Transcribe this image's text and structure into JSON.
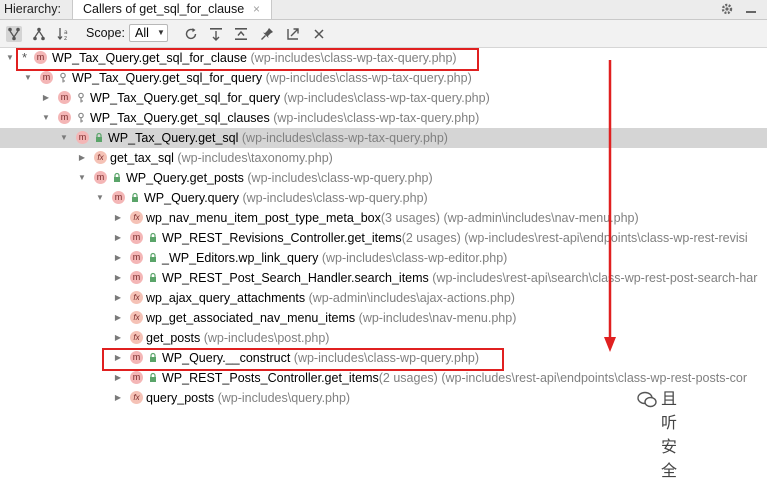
{
  "header": {
    "hierarchy_label": "Hierarchy:",
    "tab_title": "Callers of get_sql_for_clause",
    "tab_close": "×"
  },
  "toolbar": {
    "scope_label": "Scope:",
    "scope_value": "All",
    "icons": [
      "caller-hierarchy-icon",
      "callee-hierarchy-icon",
      "sort-alpha-icon",
      "refresh-icon",
      "expand-all-icon",
      "collapse-all-icon",
      "export-icon",
      "pin-icon",
      "open-external-icon",
      "close-icon"
    ]
  },
  "tree": {
    "rows": [
      {
        "name": "WP_Tax_Query.get_sql_for_clause",
        "loc": "(wp-includes\\class-wp-tax-query.php)",
        "kind": "m",
        "vis": "",
        "arrow": "expanded",
        "star": true
      },
      {
        "name": "WP_Tax_Query.get_sql_for_query",
        "loc": "(wp-includes\\class-wp-tax-query.php)",
        "kind": "m",
        "vis": "key",
        "arrow": "expanded"
      },
      {
        "name": "WP_Tax_Query.get_sql_for_query",
        "loc": "(wp-includes\\class-wp-tax-query.php)",
        "kind": "m",
        "vis": "key",
        "arrow": "collapsed"
      },
      {
        "name": "WP_Tax_Query.get_sql_clauses",
        "loc": "(wp-includes\\class-wp-tax-query.php)",
        "kind": "m",
        "vis": "key",
        "arrow": "expanded"
      },
      {
        "name": "WP_Tax_Query.get_sql",
        "loc": "(wp-includes\\class-wp-tax-query.php)",
        "kind": "m",
        "vis": "lock",
        "arrow": "expanded",
        "selected": true
      },
      {
        "name": "get_tax_sql",
        "loc": "(wp-includes\\taxonomy.php)",
        "kind": "fx",
        "vis": "",
        "arrow": "collapsed"
      },
      {
        "name": "WP_Query.get_posts",
        "loc": "(wp-includes\\class-wp-query.php)",
        "kind": "m",
        "vis": "lock",
        "arrow": "expanded"
      },
      {
        "name": "WP_Query.query",
        "loc": "(wp-includes\\class-wp-query.php)",
        "kind": "m",
        "vis": "lock",
        "arrow": "expanded"
      },
      {
        "name": "wp_nav_menu_item_post_type_meta_box",
        "usages": "(3 usages)",
        "loc": "(wp-admin\\includes\\nav-menu.php)",
        "kind": "fx",
        "vis": "",
        "arrow": "collapsed"
      },
      {
        "name": "WP_REST_Revisions_Controller.get_items",
        "usages": "(2 usages)",
        "loc": "(wp-includes\\rest-api\\endpoints\\class-wp-rest-revisi",
        "kind": "m",
        "vis": "lock",
        "arrow": "collapsed"
      },
      {
        "name": "_WP_Editors.wp_link_query",
        "loc": "(wp-includes\\class-wp-editor.php)",
        "kind": "m",
        "vis": "lock",
        "arrow": "collapsed"
      },
      {
        "name": "WP_REST_Post_Search_Handler.search_items",
        "loc": "(wp-includes\\rest-api\\search\\class-wp-rest-post-search-har",
        "kind": "m",
        "vis": "lock",
        "arrow": "collapsed"
      },
      {
        "name": "wp_ajax_query_attachments",
        "loc": "(wp-admin\\includes\\ajax-actions.php)",
        "kind": "fx",
        "vis": "",
        "arrow": "collapsed"
      },
      {
        "name": "wp_get_associated_nav_menu_items",
        "loc": "(wp-includes\\nav-menu.php)",
        "kind": "fx",
        "vis": "",
        "arrow": "collapsed"
      },
      {
        "name": "get_posts",
        "loc": "(wp-includes\\post.php)",
        "kind": "fx",
        "vis": "",
        "arrow": "collapsed"
      },
      {
        "name": "WP_Query.__construct",
        "loc": "(wp-includes\\class-wp-query.php)",
        "kind": "m",
        "vis": "lock",
        "arrow": "collapsed"
      },
      {
        "name": "WP_REST_Posts_Controller.get_items",
        "usages": "(2 usages)",
        "loc": "(wp-includes\\rest-api\\endpoints\\class-wp-rest-posts-cor",
        "kind": "m",
        "vis": "lock",
        "arrow": "collapsed"
      },
      {
        "name": "query_posts",
        "loc": "(wp-includes\\query.php)",
        "kind": "fx",
        "vis": "",
        "arrow": "collapsed"
      }
    ]
  },
  "colors": {
    "highlight": "#e02020",
    "selected_row": "#d5d5d5",
    "method_badge": "#f4b6b6",
    "location_text": "#808080"
  },
  "watermark": {
    "text": "且听安全"
  }
}
